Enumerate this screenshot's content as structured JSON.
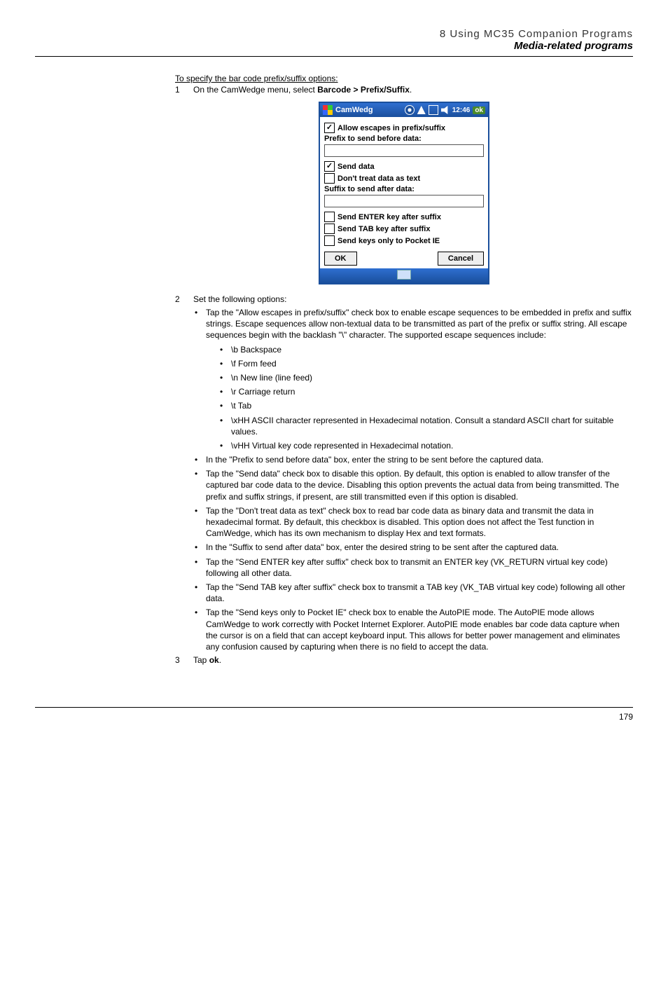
{
  "header": {
    "chapter": "8 Using MC35 Companion Programs",
    "section": "Media-related programs"
  },
  "intro": {
    "title": "To specify the bar code prefix/suffix options:",
    "step1_num": "1",
    "step1_text_a": "On the CamWedge menu, select ",
    "step1_text_b": "Barcode > Prefix/Suffix",
    "step1_text_c": "."
  },
  "device": {
    "title": "CamWedg",
    "time": "12:46",
    "ok": "ok",
    "allow_escapes": "Allow escapes in prefix/suffix",
    "prefix_label": "Prefix to send before data:",
    "send_data": "Send data",
    "dont_treat": "Don't treat data as text",
    "suffix_label": "Suffix to send after data:",
    "send_enter": "Send ENTER key after suffix",
    "send_tab": "Send TAB key after suffix",
    "send_pocket": "Send keys only to Pocket IE",
    "btn_ok": "OK",
    "btn_cancel": "Cancel"
  },
  "step2": {
    "num": "2",
    "text": "Set the following options:",
    "b1": "Tap the \"Allow escapes in prefix/suffix\" check box to enable escape sequences to be embedded in prefix and suffix strings. Escape sequences allow non-textual data to be transmitted as part of the prefix or suffix string. All escape sequences begin with the backlash \"\\\" character. The supported escape sequences include:",
    "s1": "\\b Backspace",
    "s2": "\\f Form feed",
    "s3": "\\n New line (line feed)",
    "s4": "\\r Carriage return",
    "s5": "\\t Tab",
    "s6": "\\xHH ASCII character represented in Hexadecimal notation. Consult a standard ASCII chart for suitable values.",
    "s7": "\\vHH Virtual key code represented in Hexadecimal notation.",
    "b2": "In the \"Prefix to send before data\" box, enter the string to be sent before the captured data.",
    "b3": "Tap the \"Send data\" check box to disable this option. By default, this option is enabled to allow transfer of the captured bar code data to the device. Disabling this option prevents the actual data from being transmitted. The prefix and suffix strings, if present, are still transmitted even if this option is disabled.",
    "b4": "Tap the \"Don't treat data as text\" check box to read bar code data as binary data and transmit the data in hexadecimal format. By default, this checkbox is disabled. This option does not affect the Test function in CamWedge, which has its own mechanism to display Hex and text formats.",
    "b5": "In the \"Suffix to send after data\" box, enter the desired string to be sent after the captured data.",
    "b6": "Tap the \"Send ENTER key after suffix\" check box to transmit an ENTER key (VK_RETURN virtual key code) following all other data.",
    "b7": "Tap the \"Send TAB key after suffix\" check box to transmit a TAB key (VK_TAB virtual key code) following all other data.",
    "b8": "Tap the \"Send keys only to Pocket IE\" check box to enable the AutoPIE mode. The AutoPIE mode allows CamWedge to work correctly with Pocket Internet Explorer. AutoPIE mode enables bar code data capture when the cursor is on a field that can accept keyboard input. This allows for better power management and eliminates any confusion caused by capturing when there is no field to accept the data."
  },
  "step3": {
    "num": "3",
    "text_a": "Tap ",
    "text_b": "ok",
    "text_c": "."
  },
  "page": "179"
}
